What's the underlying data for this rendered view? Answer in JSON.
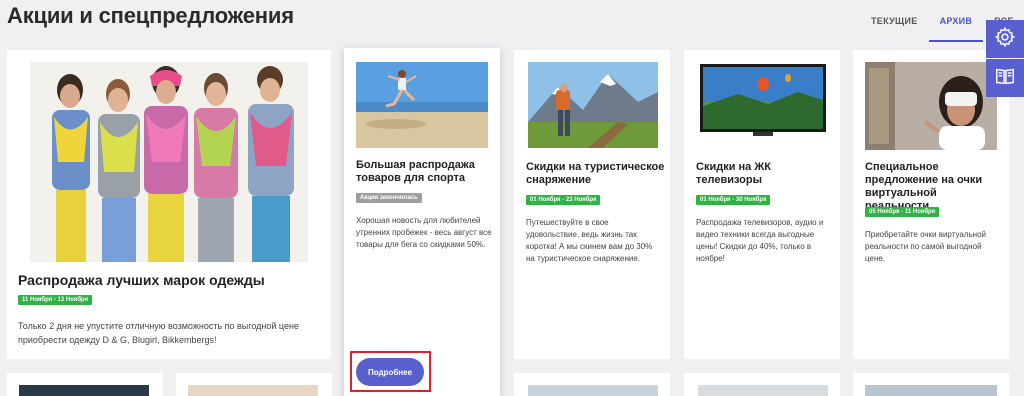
{
  "page": {
    "title": "Акции и спецпредложения"
  },
  "tabs": [
    {
      "label": "ТЕКУЩИЕ"
    },
    {
      "label": "АРХИВ"
    },
    {
      "label": "ВСЕ"
    }
  ],
  "side_buttons": {
    "settings_icon": "gear-icon",
    "book_icon": "book-icon"
  },
  "cards": {
    "big": {
      "title": "Распродажа лучших марок одежды",
      "dates": "11 Ноября - 13 Ноября",
      "desc": "Только 2 дня не упустите отличную возможность по выгодной цене приобрести одежду D & G, Blugirl, Bikkembergs!"
    },
    "sport": {
      "title": "Большая распродажа товаров для спорта",
      "status": "Акция закончилась",
      "desc": "Хорошая новость для любителей утренних пробежек - весь август все товары для бега со скидками 50%.",
      "button": "Подробнее"
    },
    "tour": {
      "title": "Скидки на туристическое снаряжение",
      "dates": "01 Ноября - 23 Ноября",
      "desc": "Путешествуйте в свое удовольствие, ведь жизнь так коротка! А мы скинем вам до 30% на туристическое снаряжение."
    },
    "tv": {
      "title": "Скидки на ЖК телевизоры",
      "dates": "01 Ноября - 30 Ноября",
      "desc": "Распродажа телевизоров, аудио и видео техники всегда выгодные цены! Скидки до 40%, только в ноябре!"
    },
    "vr": {
      "title": "Специальное предложение на очки виртуальной реальности",
      "dates": "05 Ноября - 11 Ноября",
      "desc": "Приобретайте очки виртуальной реальности по самой выгодной цене."
    }
  },
  "colors": {
    "accent": "#5a5fd0",
    "badge_green": "#2fb344",
    "badge_grey": "#9e9e9e",
    "highlight": "#e0202b"
  }
}
